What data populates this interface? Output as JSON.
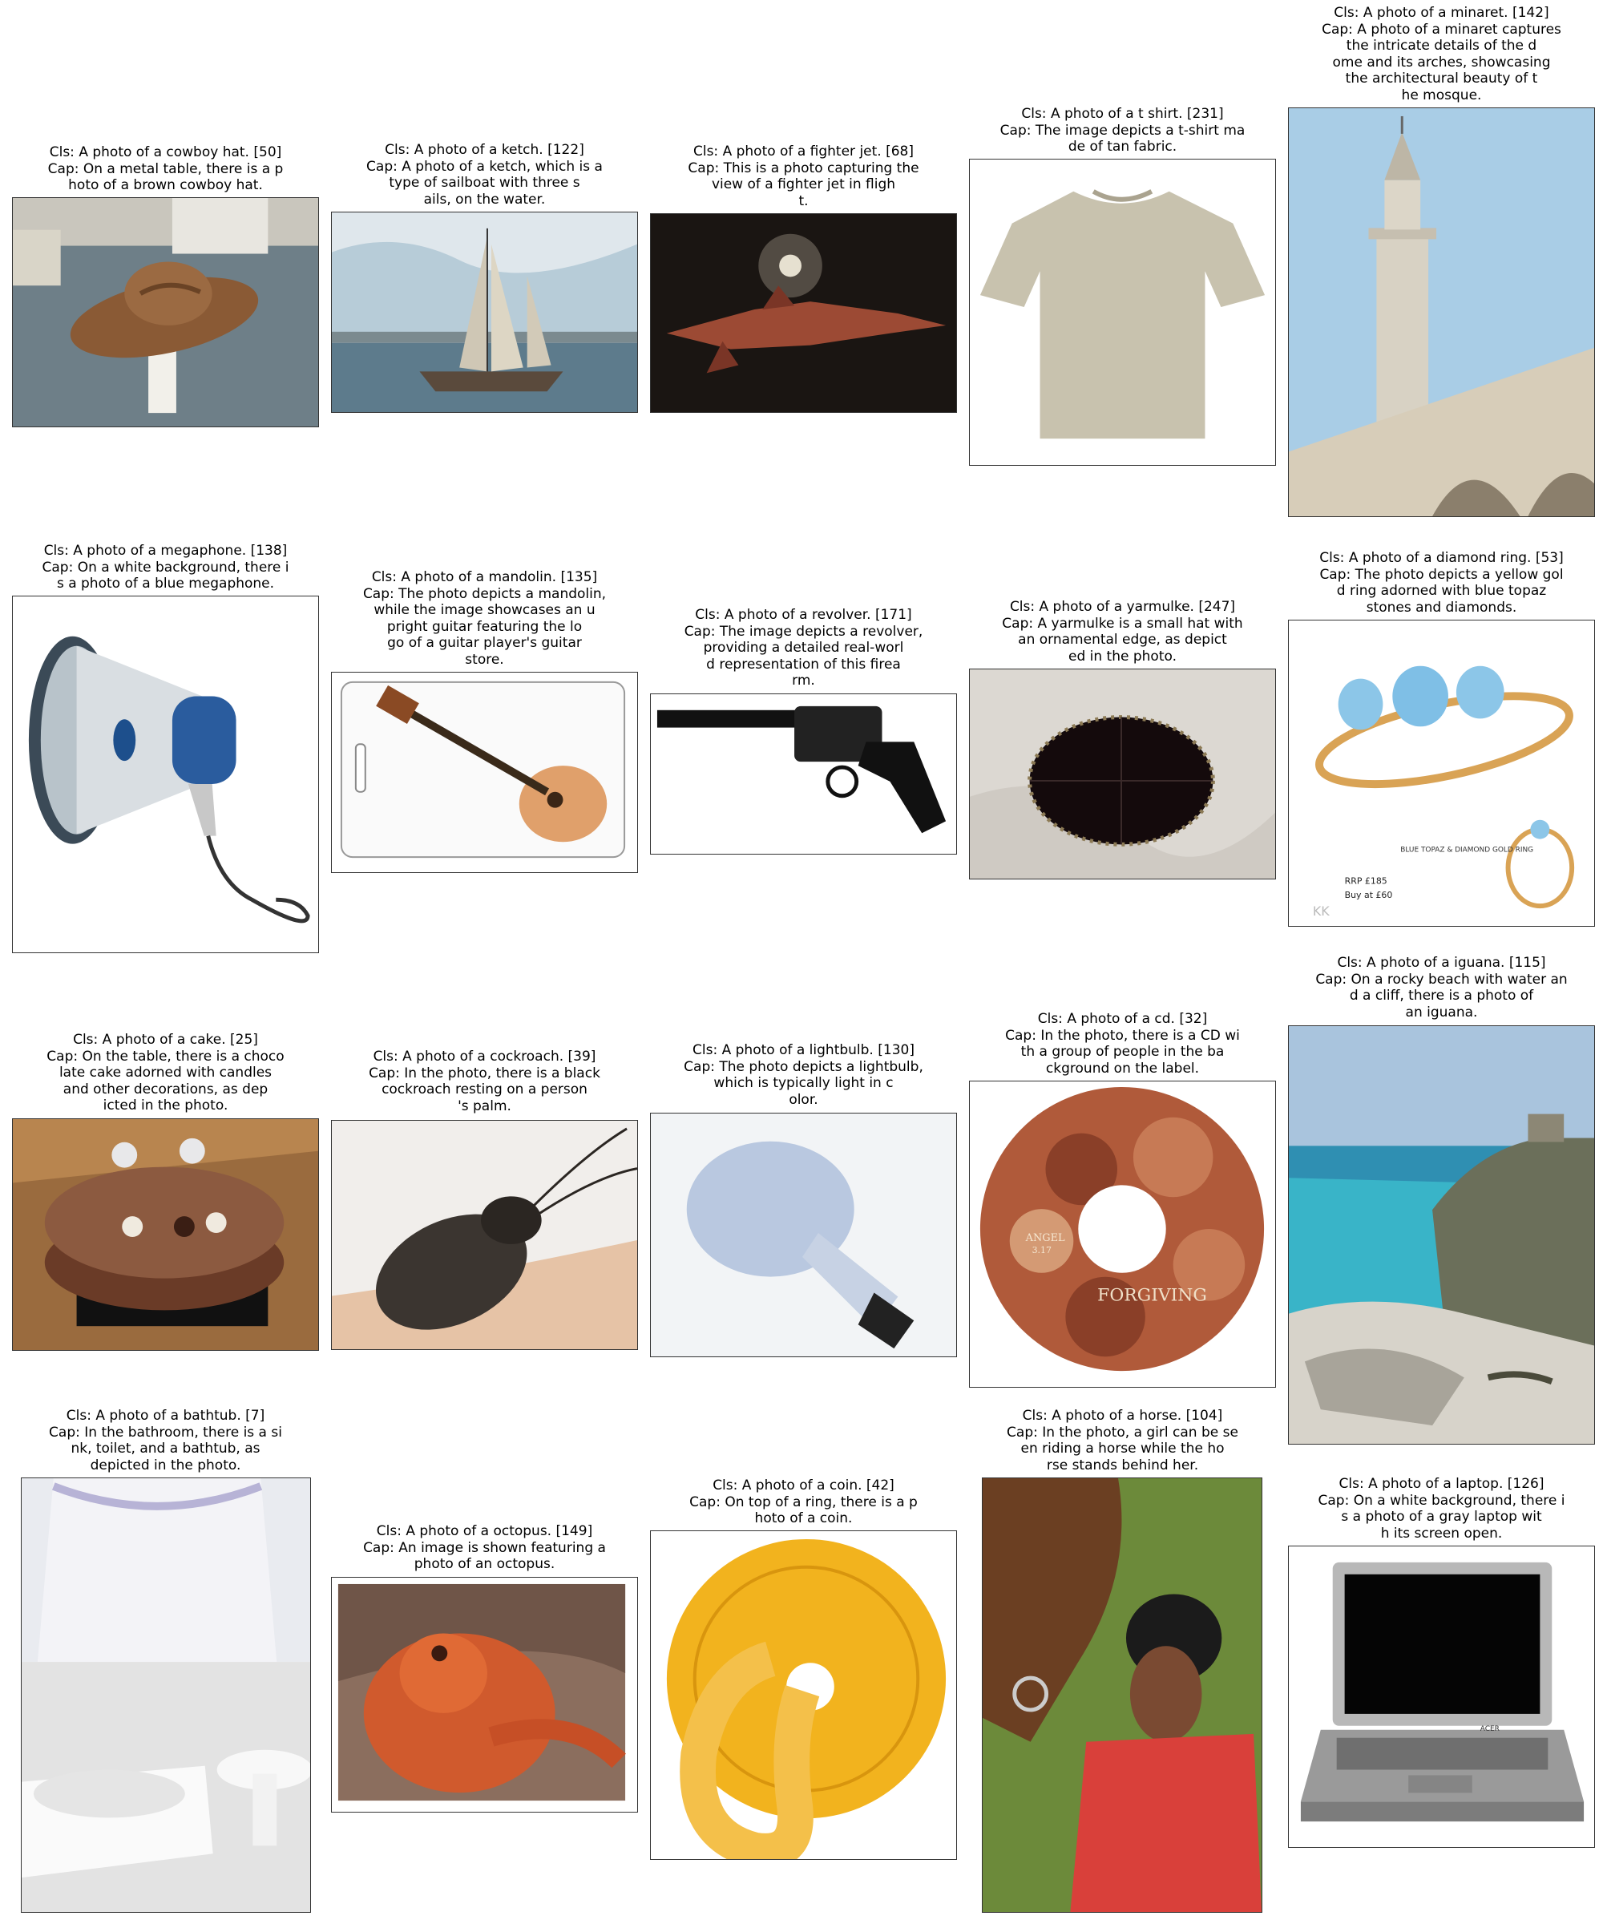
{
  "panels": [
    {
      "label": "Cls: A photo of a cowboy hat. [50]\nCap: On a metal table, there is a p\nhoto of a brown cowboy hat.",
      "subject": "cowboy-hat"
    },
    {
      "label": "Cls: A photo of a ketch. [122]\nCap: A photo of a ketch, which is a\ntype of sailboat with three s\nails, on the water.",
      "subject": "ketch"
    },
    {
      "label": "Cls: A photo of a fighter jet. [68]\nCap: This is a photo capturing the\nview of a fighter jet in fligh\nt.",
      "subject": "fighter-jet"
    },
    {
      "label": "Cls: A photo of a t shirt. [231]\nCap: The image depicts a t-shirt ma\nde of tan fabric.",
      "subject": "t-shirt"
    },
    {
      "label": "Cls: A photo of a minaret. [142]\nCap: A photo of a minaret captures\nthe intricate details of the d\nome and its arches, showcasing\nthe architectural beauty of t\nhe mosque.",
      "subject": "minaret"
    },
    {
      "label": "Cls: A photo of a megaphone. [138]\nCap: On a white background, there i\ns a photo of a blue megaphone.",
      "subject": "megaphone"
    },
    {
      "label": "Cls: A photo of a mandolin. [135]\nCap: The photo depicts a mandolin,\nwhile the image showcases an u\npright guitar featuring the lo\ngo of a guitar player's guitar\nstore.",
      "subject": "mandolin"
    },
    {
      "label": "Cls: A photo of a revolver. [171]\nCap: The image depicts a revolver,\nproviding a detailed real-worl\nd representation of this firea\nrm.",
      "subject": "revolver"
    },
    {
      "label": "Cls: A photo of a yarmulke. [247]\nCap: A yarmulke is a small hat with\nan ornamental edge, as depict\ned in the photo.",
      "subject": "yarmulke"
    },
    {
      "label": "Cls: A photo of a diamond ring. [53]\nCap: The photo depicts a yellow gol\nd ring adorned with blue topaz\nstones and diamonds.",
      "subject": "diamond-ring"
    },
    {
      "label": "Cls: A photo of a cake. [25]\nCap: On the table, there is a choco\nlate cake adorned with candles\nand other decorations, as dep\nicted in the photo.",
      "subject": "cake"
    },
    {
      "label": "Cls: A photo of a cockroach. [39]\nCap: In the photo, there is a black\ncockroach resting on a person\n's palm.",
      "subject": "cockroach"
    },
    {
      "label": "Cls: A photo of a lightbulb. [130]\nCap: The photo depicts a lightbulb,\nwhich is typically light in c\nolor.",
      "subject": "lightbulb"
    },
    {
      "label": "Cls: A photo of a cd. [32]\nCap: In the photo, there is a CD wi\nth a group of people in the ba\nckground on the label.",
      "subject": "cd"
    },
    {
      "label": "Cls: A photo of a iguana. [115]\nCap: On a rocky beach with water an\nd a cliff, there is a photo of\nan iguana.",
      "subject": "iguana"
    },
    {
      "label": "Cls: A photo of a bathtub. [7]\nCap: In the bathroom, there is a si\nnk, toilet, and a bathtub, as\ndepicted in the photo.",
      "subject": "bathtub"
    },
    {
      "label": "Cls: A photo of a octopus. [149]\nCap: An image is shown featuring a\nphoto of an octopus.",
      "subject": "octopus"
    },
    {
      "label": "Cls: A photo of a coin. [42]\nCap: On top of a ring, there is a p\nhoto of a coin.",
      "subject": "coin"
    },
    {
      "label": "Cls: A photo of a horse. [104]\nCap: In the photo, a girl can be se\nen riding a horse while the ho\nrse stands behind her.",
      "subject": "horse"
    },
    {
      "label": "Cls: A photo of a laptop. [126]\nCap: On a white background, there i\ns a photo of a gray laptop wit\nh its screen open.",
      "subject": "laptop"
    }
  ],
  "image_text": {
    "ring_note": "BLUE TOPAZ & DIAMOND GOLD RING",
    "ring_price": "RRP £185",
    "ring_buy": "Buy at £60",
    "ring_mark": "KK",
    "cd_title": "FORGIVING",
    "cd_angel": "ANGEL",
    "cd_ep": "3.17",
    "laptop_brand": "ACER"
  }
}
